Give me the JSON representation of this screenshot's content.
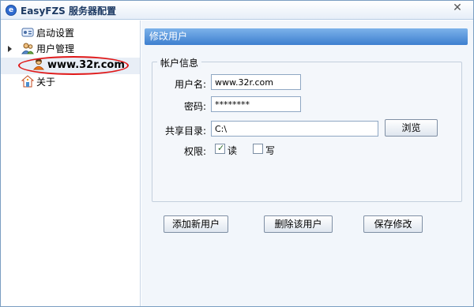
{
  "window": {
    "title": "EasyFZS 服务器配置",
    "close_glyph": "✕"
  },
  "sidebar": {
    "items": [
      {
        "label": "启动设置",
        "icon": "startup-settings-icon"
      },
      {
        "label": "用户管理",
        "icon": "user-management-icon"
      },
      {
        "label": "www.32r.com",
        "icon": "user-icon"
      },
      {
        "label": "关于",
        "icon": "about-icon"
      }
    ]
  },
  "main": {
    "header": "修改用户",
    "account_info_legend": "帐户信息",
    "fields": {
      "username_label": "用户名:",
      "username_value": "www.32r.com",
      "password_label": "密码:",
      "password_value": "********",
      "share_dir_label": "共享目录:",
      "share_dir_value": "C:\\",
      "browse_button": "浏览",
      "permission_label": "权限:",
      "read_label": "读",
      "read_checked": true,
      "write_label": "写",
      "write_checked": false
    },
    "buttons": {
      "add_user": "添加新用户",
      "delete_user": "删除该用户",
      "save_changes": "保存修改"
    }
  },
  "colors": {
    "header_bg": "#3d7fcf",
    "highlight": "#e01818"
  }
}
